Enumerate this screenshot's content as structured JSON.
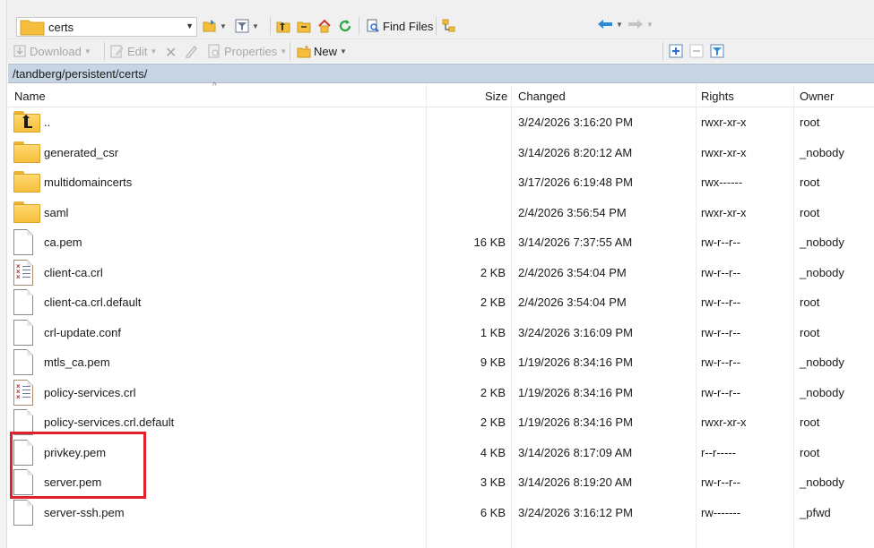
{
  "toolbar1": {
    "path_combo": "certs",
    "find_files": "Find Files"
  },
  "toolbar2": {
    "download": "Download",
    "edit": "Edit",
    "properties": "Properties",
    "new": "New"
  },
  "path_bar": "/tandberg/persistent/certs/",
  "columns": {
    "name": "Name",
    "size": "Size",
    "changed": "Changed",
    "rights": "Rights",
    "owner": "Owner"
  },
  "files": [
    {
      "name": "..",
      "type": "parent",
      "size": "",
      "changed": "3/24/2026 3:16:20 PM",
      "rights": "rwxr-xr-x",
      "owner": "root"
    },
    {
      "name": "generated_csr",
      "type": "folder",
      "size": "",
      "changed": "3/14/2026 8:20:12 AM",
      "rights": "rwxr-xr-x",
      "owner": "_nobody"
    },
    {
      "name": "multidomaincerts",
      "type": "folder",
      "size": "",
      "changed": "3/17/2026 6:19:48 PM",
      "rights": "rwx------",
      "owner": "root"
    },
    {
      "name": "saml",
      "type": "folder",
      "size": "",
      "changed": "2/4/2026 3:56:54 PM",
      "rights": "rwxr-xr-x",
      "owner": "root"
    },
    {
      "name": "ca.pem",
      "type": "file",
      "size": "16 KB",
      "changed": "3/14/2026 7:37:55 AM",
      "rights": "rw-r--r--",
      "owner": "_nobody"
    },
    {
      "name": "client-ca.crl",
      "type": "crl",
      "size": "2 KB",
      "changed": "2/4/2026 3:54:04 PM",
      "rights": "rw-r--r--",
      "owner": "_nobody"
    },
    {
      "name": "client-ca.crl.default",
      "type": "file",
      "size": "2 KB",
      "changed": "2/4/2026 3:54:04 PM",
      "rights": "rw-r--r--",
      "owner": "root"
    },
    {
      "name": "crl-update.conf",
      "type": "file",
      "size": "1 KB",
      "changed": "3/24/2026 3:16:09 PM",
      "rights": "rw-r--r--",
      "owner": "root"
    },
    {
      "name": "mtls_ca.pem",
      "type": "file",
      "size": "9 KB",
      "changed": "1/19/2026 8:34:16 PM",
      "rights": "rw-r--r--",
      "owner": "_nobody"
    },
    {
      "name": "policy-services.crl",
      "type": "crl",
      "size": "2 KB",
      "changed": "1/19/2026 8:34:16 PM",
      "rights": "rw-r--r--",
      "owner": "_nobody"
    },
    {
      "name": "policy-services.crl.default",
      "type": "file",
      "size": "2 KB",
      "changed": "1/19/2026 8:34:16 PM",
      "rights": "rwxr-xr-x",
      "owner": "root"
    },
    {
      "name": "privkey.pem",
      "type": "file",
      "size": "4 KB",
      "changed": "3/14/2026 8:17:09 AM",
      "rights": "r--r-----",
      "owner": "root"
    },
    {
      "name": "server.pem",
      "type": "file",
      "size": "3 KB",
      "changed": "3/14/2026 8:19:20 AM",
      "rights": "rw-r--r--",
      "owner": "_nobody"
    },
    {
      "name": "server-ssh.pem",
      "type": "file",
      "size": "6 KB",
      "changed": "3/24/2026 3:16:12 PM",
      "rights": "rw-------",
      "owner": "_pfwd"
    }
  ],
  "colors": {
    "path_bar_bg": "#c7d4e3",
    "folder": "#f5bf3c",
    "highlight": "#e3212b"
  }
}
